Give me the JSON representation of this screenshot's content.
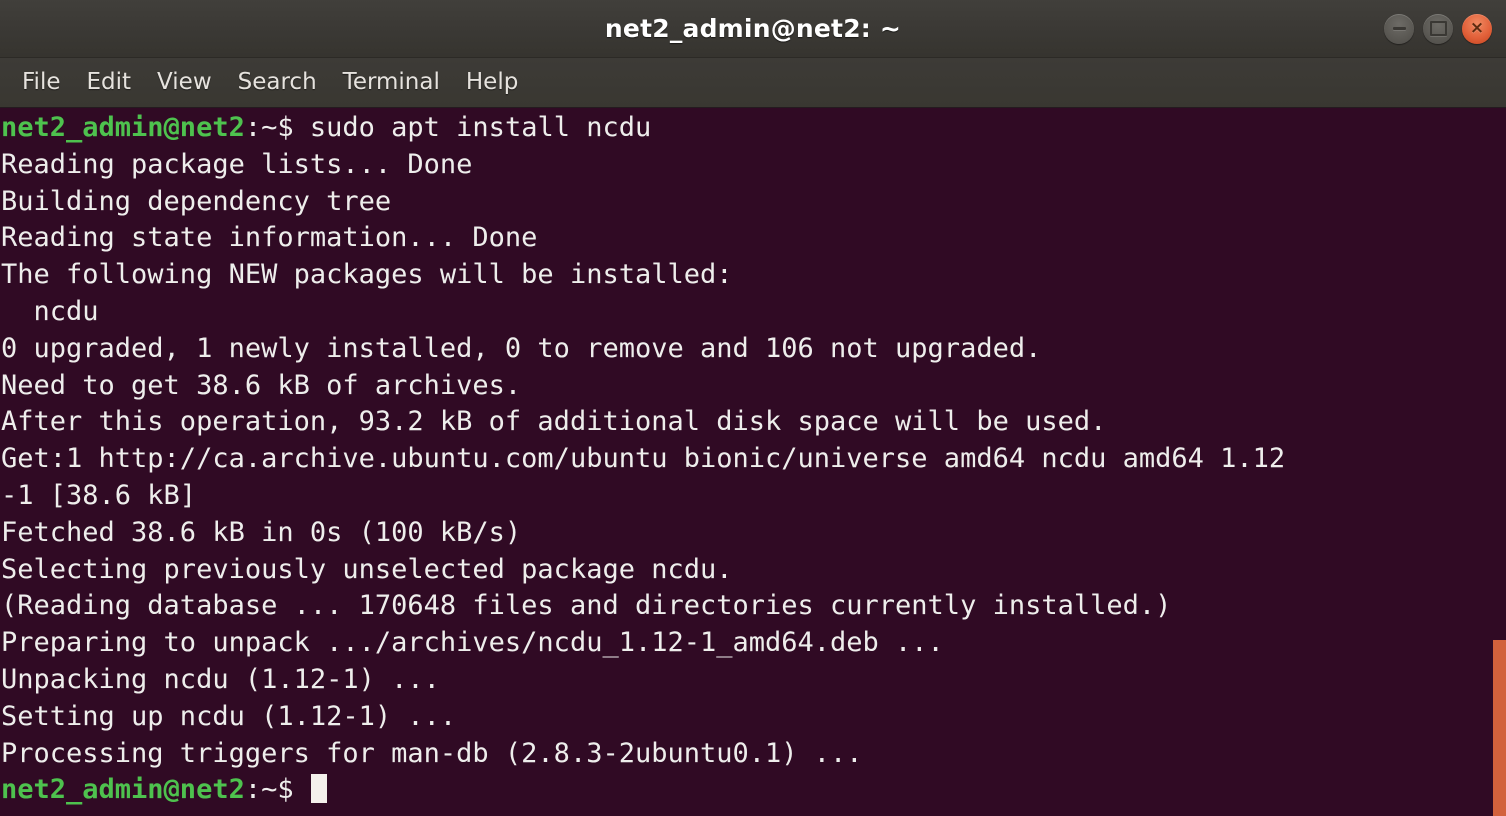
{
  "window": {
    "title": "net2_admin@net2: ~",
    "controls": [
      {
        "name": "minimize",
        "glyph": "minimize-icon"
      },
      {
        "name": "maximize",
        "glyph": "maximize-icon"
      },
      {
        "name": "close",
        "glyph": "close-icon",
        "label": "×",
        "color": "#e2613a"
      }
    ]
  },
  "menubar": {
    "items": [
      {
        "label": "File"
      },
      {
        "label": "Edit"
      },
      {
        "label": "View"
      },
      {
        "label": "Search"
      },
      {
        "label": "Terminal"
      },
      {
        "label": "Help"
      }
    ]
  },
  "terminal": {
    "colors": {
      "background": "#300a24",
      "foreground": "#e8e4e0",
      "prompt_green": "#4ec24e",
      "scrollbar_thumb": "#d2613c"
    },
    "prompt": "net2_admin@net2",
    "prompt_suffix": ":~$ ",
    "command": "sudo apt install ncdu",
    "lines": [
      {
        "type": "prompt",
        "prompt": "net2_admin@net2",
        "suffix": ":~$ ",
        "text": "sudo apt install ncdu"
      },
      {
        "type": "out",
        "text": "Reading package lists... Done"
      },
      {
        "type": "out",
        "text": "Building dependency tree"
      },
      {
        "type": "out",
        "text": "Reading state information... Done"
      },
      {
        "type": "out",
        "text": "The following NEW packages will be installed:"
      },
      {
        "type": "out",
        "text": "  ncdu"
      },
      {
        "type": "out",
        "text": "0 upgraded, 1 newly installed, 0 to remove and 106 not upgraded."
      },
      {
        "type": "out",
        "text": "Need to get 38.6 kB of archives."
      },
      {
        "type": "out",
        "text": "After this operation, 93.2 kB of additional disk space will be used."
      },
      {
        "type": "out",
        "text": "Get:1 http://ca.archive.ubuntu.com/ubuntu bionic/universe amd64 ncdu amd64 1.12"
      },
      {
        "type": "out",
        "text": "-1 [38.6 kB]"
      },
      {
        "type": "out",
        "text": "Fetched 38.6 kB in 0s (100 kB/s)"
      },
      {
        "type": "out",
        "text": "Selecting previously unselected package ncdu."
      },
      {
        "type": "out",
        "text": "(Reading database ... 170648 files and directories currently installed.)"
      },
      {
        "type": "out",
        "text": "Preparing to unpack .../archives/ncdu_1.12-1_amd64.deb ..."
      },
      {
        "type": "out",
        "text": "Unpacking ncdu (1.12-1) ..."
      },
      {
        "type": "out",
        "text": "Setting up ncdu (1.12-1) ..."
      },
      {
        "type": "out",
        "text": "Processing triggers for man-db (2.8.3-2ubuntu0.1) ..."
      },
      {
        "type": "prompt-cursor",
        "prompt": "net2_admin@net2",
        "suffix": ":~$ ",
        "text": ""
      }
    ],
    "scrollbar": {
      "thumb_top_pct": 75,
      "thumb_height_pct": 25
    }
  }
}
